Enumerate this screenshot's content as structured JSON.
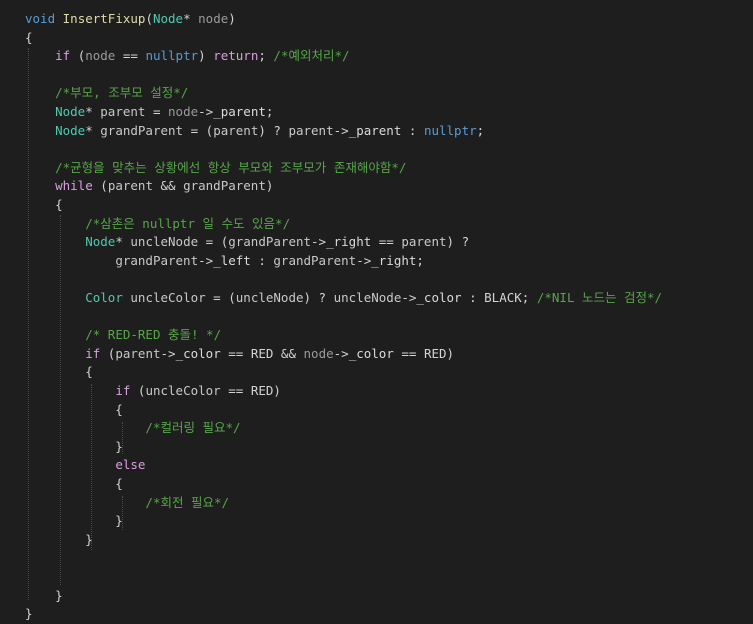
{
  "code": {
    "lines": [
      [
        {
          "t": "void",
          "c": "kw"
        },
        {
          "t": " "
        },
        {
          "t": "InsertFixup",
          "c": "fn"
        },
        {
          "t": "("
        },
        {
          "t": "Node",
          "c": "ty"
        },
        {
          "t": "* "
        },
        {
          "t": "node",
          "c": "param"
        },
        {
          "t": ")"
        }
      ],
      [
        {
          "t": "{"
        }
      ],
      [
        {
          "t": "    "
        },
        {
          "t": "if",
          "c": "ctrl"
        },
        {
          "t": " ("
        },
        {
          "t": "node",
          "c": "param"
        },
        {
          "t": " == "
        },
        {
          "t": "nullptr",
          "c": "kw"
        },
        {
          "t": ") "
        },
        {
          "t": "return",
          "c": "ctrl"
        },
        {
          "t": "; "
        },
        {
          "t": "/*예외처리*/",
          "c": "cm"
        }
      ],
      [],
      [
        {
          "t": "    "
        },
        {
          "t": "/*부모, 조부모 설정*/",
          "c": "cm"
        }
      ],
      [
        {
          "t": "    "
        },
        {
          "t": "Node",
          "c": "ty"
        },
        {
          "t": "* "
        },
        {
          "t": "parent",
          "c": "var"
        },
        {
          "t": " = "
        },
        {
          "t": "node",
          "c": "param"
        },
        {
          "t": "->"
        },
        {
          "t": "_parent",
          "c": "mem"
        },
        {
          "t": ";"
        }
      ],
      [
        {
          "t": "    "
        },
        {
          "t": "Node",
          "c": "ty"
        },
        {
          "t": "* "
        },
        {
          "t": "grandParent",
          "c": "var"
        },
        {
          "t": " = ("
        },
        {
          "t": "parent",
          "c": "var"
        },
        {
          "t": ") ? "
        },
        {
          "t": "parent",
          "c": "var"
        },
        {
          "t": "->"
        },
        {
          "t": "_parent",
          "c": "mem"
        },
        {
          "t": " : "
        },
        {
          "t": "nullptr",
          "c": "kw"
        },
        {
          "t": ";"
        }
      ],
      [],
      [
        {
          "t": "    "
        },
        {
          "t": "/*균형을 맞추는 상황에선 항상 부모와 조부모가 존재해야함*/",
          "c": "cm"
        }
      ],
      [
        {
          "t": "    "
        },
        {
          "t": "while",
          "c": "ctrl"
        },
        {
          "t": " ("
        },
        {
          "t": "parent",
          "c": "var"
        },
        {
          "t": " && "
        },
        {
          "t": "grandParent",
          "c": "var"
        },
        {
          "t": ")"
        }
      ],
      [
        {
          "t": "    {"
        }
      ],
      [
        {
          "t": "        "
        },
        {
          "t": "/*삼촌은 nullptr 일 수도 있음*/",
          "c": "cm"
        }
      ],
      [
        {
          "t": "        "
        },
        {
          "t": "Node",
          "c": "ty"
        },
        {
          "t": "* "
        },
        {
          "t": "uncleNode",
          "c": "var"
        },
        {
          "t": " = ("
        },
        {
          "t": "grandParent",
          "c": "var"
        },
        {
          "t": "->"
        },
        {
          "t": "_right",
          "c": "mem"
        },
        {
          "t": " == "
        },
        {
          "t": "parent",
          "c": "var"
        },
        {
          "t": ") ?"
        }
      ],
      [
        {
          "t": "            "
        },
        {
          "t": "grandParent",
          "c": "var"
        },
        {
          "t": "->"
        },
        {
          "t": "_left",
          "c": "mem"
        },
        {
          "t": " : "
        },
        {
          "t": "grandParent",
          "c": "var"
        },
        {
          "t": "->"
        },
        {
          "t": "_right",
          "c": "mem"
        },
        {
          "t": ";"
        }
      ],
      [],
      [
        {
          "t": "        "
        },
        {
          "t": "Color",
          "c": "ty"
        },
        {
          "t": " "
        },
        {
          "t": "uncleColor",
          "c": "var"
        },
        {
          "t": " = ("
        },
        {
          "t": "uncleNode",
          "c": "var"
        },
        {
          "t": ") ? "
        },
        {
          "t": "uncleNode",
          "c": "var"
        },
        {
          "t": "->"
        },
        {
          "t": "_color",
          "c": "mem"
        },
        {
          "t": " : "
        },
        {
          "t": "BLACK",
          "c": "txt"
        },
        {
          "t": "; "
        },
        {
          "t": "/*NIL 노드는 검정*/",
          "c": "cm"
        }
      ],
      [],
      [
        {
          "t": "        "
        },
        {
          "t": "/* RED-RED 충돌! */",
          "c": "cm"
        }
      ],
      [
        {
          "t": "        "
        },
        {
          "t": "if",
          "c": "ctrl"
        },
        {
          "t": " ("
        },
        {
          "t": "parent",
          "c": "var"
        },
        {
          "t": "->"
        },
        {
          "t": "_color",
          "c": "mem"
        },
        {
          "t": " == "
        },
        {
          "t": "RED",
          "c": "txt"
        },
        {
          "t": " && "
        },
        {
          "t": "node",
          "c": "param"
        },
        {
          "t": "->"
        },
        {
          "t": "_color",
          "c": "mem"
        },
        {
          "t": " == "
        },
        {
          "t": "RED",
          "c": "txt"
        },
        {
          "t": ")"
        }
      ],
      [
        {
          "t": "        {"
        }
      ],
      [
        {
          "t": "            "
        },
        {
          "t": "if",
          "c": "ctrl"
        },
        {
          "t": " ("
        },
        {
          "t": "uncleColor",
          "c": "var"
        },
        {
          "t": " == "
        },
        {
          "t": "RED",
          "c": "txt"
        },
        {
          "t": ")"
        }
      ],
      [
        {
          "t": "            {"
        }
      ],
      [
        {
          "t": "                "
        },
        {
          "t": "/*컬러링 필요*/",
          "c": "cm"
        }
      ],
      [
        {
          "t": "            }"
        }
      ],
      [
        {
          "t": "            "
        },
        {
          "t": "else",
          "c": "ctrl"
        }
      ],
      [
        {
          "t": "            {"
        }
      ],
      [
        {
          "t": "                "
        },
        {
          "t": "/*회전 필요*/",
          "c": "cm"
        }
      ],
      [
        {
          "t": "            }"
        }
      ],
      [
        {
          "t": "        }"
        }
      ],
      [],
      [],
      [
        {
          "t": "    }"
        }
      ],
      [
        {
          "t": "}"
        }
      ]
    ]
  },
  "colors": {
    "background": "#1e1e1e",
    "keyword": "#569cd6",
    "control": "#d8a0df",
    "function": "#dcdcaa",
    "type": "#4ec9b0",
    "parameter": "#9a9a9a",
    "comment": "#57a64a",
    "plain": "#d4d4d4"
  }
}
